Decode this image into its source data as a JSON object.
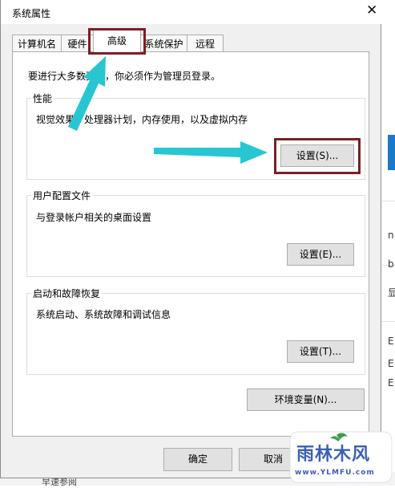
{
  "window": {
    "title": "系统属性",
    "close_glyph": "✕"
  },
  "tabs": [
    {
      "label": "计算机名"
    },
    {
      "label": "硬件"
    },
    {
      "label": "高级"
    },
    {
      "label": "系统保护"
    },
    {
      "label": "远程"
    }
  ],
  "notice": "要进行大多数更改，你必须作为管理员登录。",
  "performance": {
    "legend": "性能",
    "desc": "视觉效果，处理器计划，内存使用，以及虚拟内存",
    "button": "设置(S)..."
  },
  "user_profiles": {
    "legend": "用户配置文件",
    "desc": "与登录帐户相关的桌面设置",
    "button": "设置(E)..."
  },
  "startup": {
    "legend": "启动和故障恢复",
    "desc": "系统启动、系统故障和调试信息",
    "button": "设置(T)..."
  },
  "env_button": "环境变量(N)...",
  "ok_button": "确定",
  "cancel_button": "取消",
  "background": {
    "chars": [
      "n",
      "b",
      "显",
      "E",
      "E",
      "E"
    ],
    "bottom_text": "早速参阅"
  },
  "watermark": {
    "text": "雨林木风",
    "url": "www.YLMFU.com"
  },
  "colors": {
    "highlight": "#7b1f24",
    "arrow": "#27c6d2",
    "button": "#e1e1e1"
  }
}
